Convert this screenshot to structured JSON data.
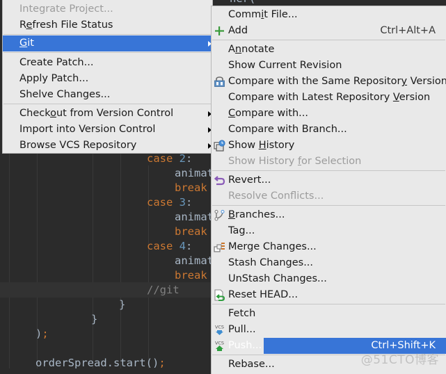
{
  "editor": {
    "top_fragment": "ner(",
    "lines": [
      {
        "indent": "case ",
        "kw": "case",
        "num": "2",
        "rest": ":"
      },
      {
        "ident": "animat"
      },
      {
        "kw": "break"
      },
      {
        "kw": "case",
        "num": "3",
        "rest": ":"
      },
      {
        "ident": "animat"
      },
      {
        "kw": "break"
      },
      {
        "kw": "case",
        "num": "4",
        "rest": ":"
      },
      {
        "ident": "animat"
      },
      {
        "kw": "break"
      }
    ],
    "comment": "//git",
    "brace1": "}",
    "brace2": "}",
    "close_paren": ")",
    "semicolon": ";",
    "last_line_obj": "orderSpread.start()",
    "last_line_semi": ";",
    "case2_kw": "case",
    "case2_num": "2",
    "case3_kw": "case",
    "case3_num": "3",
    "case4_kw": "case",
    "case4_num": "4",
    "colon": ":",
    "anim": "animat",
    "brk": "break"
  },
  "vcs_menu": {
    "items": [
      {
        "label": "Integrate Project...",
        "disabled": true
      },
      {
        "label_pre": "R",
        "label_u": "e",
        "label_post": "fresh File Status"
      },
      {
        "label_pre": "",
        "label_u": "G",
        "label_post": "it",
        "selected": true,
        "submenu": true
      },
      {
        "label": "Create Patch..."
      },
      {
        "label": "Apply Patch..."
      },
      {
        "label": "Shelve Changes..."
      },
      {
        "label_pre": "Check",
        "label_u": "o",
        "label_post": "ut from Version Control",
        "submenu": true
      },
      {
        "label": "Import into Version Control",
        "submenu": true
      },
      {
        "label": "Browse VCS Repository",
        "submenu": true
      }
    ]
  },
  "git_menu": {
    "items": [
      {
        "label_pre": "Comm",
        "label_u": "i",
        "label_post": "t File..."
      },
      {
        "label": "Add",
        "icon": "plus-icon",
        "shortcut": "Ctrl+Alt+A"
      },
      {
        "label_pre": "A",
        "label_u": "n",
        "label_post": "notate"
      },
      {
        "label": "Show Current Revision"
      },
      {
        "label_pre": "Compare with the Same Repositor",
        "label_u": "y",
        "label_post": " Version",
        "icon": "compare-repository-icon"
      },
      {
        "label_pre": "Compare with Latest Repository ",
        "label_u": "V",
        "label_post": "ersion"
      },
      {
        "label_pre": "",
        "label_u": "C",
        "label_post": "ompare with..."
      },
      {
        "label": "Compare with Branch..."
      },
      {
        "label_pre": "Show ",
        "label_u": "H",
        "label_post": "istory",
        "icon": "history-icon"
      },
      {
        "label_pre": "Show History ",
        "label_u": "f",
        "label_post": "or Selection",
        "disabled": true
      },
      {
        "label": "Revert...",
        "icon": "revert-icon"
      },
      {
        "label": "Resolve Conflicts...",
        "disabled": true
      },
      {
        "label_pre": "",
        "label_u": "B",
        "label_post": "ranches...",
        "icon": "branches-icon"
      },
      {
        "label": "Tag..."
      },
      {
        "label": "Merge Changes...",
        "icon": "merge-icon"
      },
      {
        "label": "Stash Changes..."
      },
      {
        "label": "UnStash Changes..."
      },
      {
        "label": "Reset HEAD...",
        "icon": "reset-head-icon"
      },
      {
        "label": "Fetch"
      },
      {
        "label": "Pull...",
        "icon": "vcs-pull-icon"
      },
      {
        "label": "Push...",
        "icon": "vcs-push-icon",
        "shortcut": "Ctrl+Shift+K",
        "selected": true
      },
      {
        "label": "Rebase..."
      }
    ]
  },
  "icons": {
    "vcs_text": "VCS"
  },
  "colors": {
    "selection": "#3875d7",
    "menu_bg": "#e9e9e9",
    "editor_bg": "#2b2b2b",
    "keyword": "#cc7832",
    "number": "#6897bb",
    "comment": "#808080"
  },
  "watermark": "@51CTO博客"
}
